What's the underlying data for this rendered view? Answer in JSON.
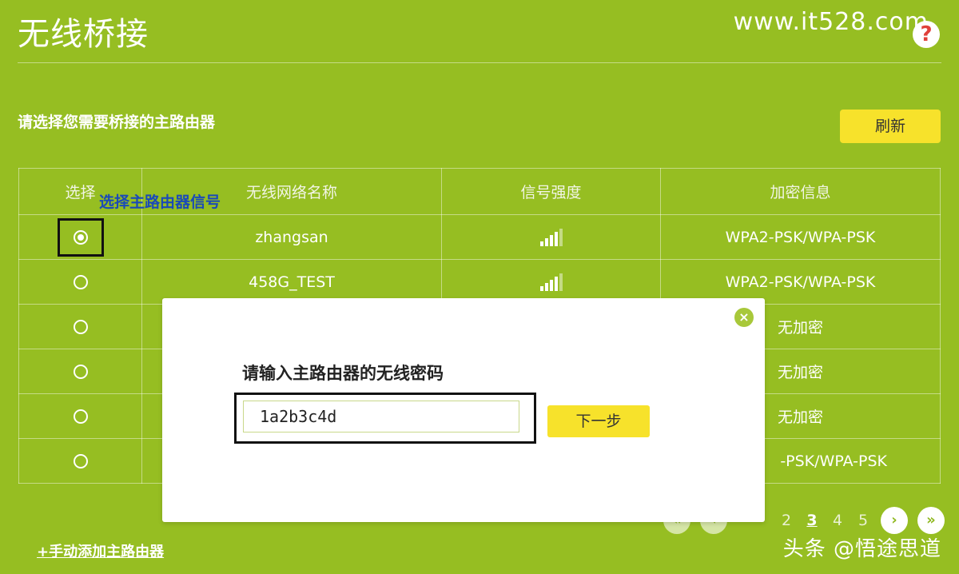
{
  "header": {
    "title": "无线桥接",
    "site_watermark": "www.it528.com",
    "help_label": "?"
  },
  "section": {
    "label": "请选择您需要桥接的主路由器",
    "refresh_label": "刷新"
  },
  "table": {
    "columns": [
      "选择",
      "无线网络名称",
      "信号强度",
      "加密信息"
    ],
    "rows": [
      {
        "selected": true,
        "ssid": "zhangsan",
        "signal_level": 4,
        "encryption": "WPA2-PSK/WPA-PSK"
      },
      {
        "selected": false,
        "ssid": "458G_TEST",
        "signal_level": 4,
        "encryption": "WPA2-PSK/WPA-PSK"
      },
      {
        "selected": false,
        "ssid": "",
        "signal_level": null,
        "encryption": "无加密"
      },
      {
        "selected": false,
        "ssid": "",
        "signal_level": null,
        "encryption": "无加密"
      },
      {
        "selected": false,
        "ssid": "",
        "signal_level": null,
        "encryption": "无加密"
      },
      {
        "selected": false,
        "ssid": "",
        "signal_level": null,
        "encryption": "-PSK/WPA-PSK"
      }
    ]
  },
  "annotation": "选择主路由器信号",
  "add_router_link": "+手动添加主路由器",
  "pagination": {
    "first_icon": "first-page-icon",
    "prev_icon": "prev-page-icon",
    "next_icon": "next-page-icon",
    "last_icon": "last-page-icon",
    "pages": [
      "2",
      "3",
      "4",
      "5"
    ],
    "current_page": "3"
  },
  "modal": {
    "label": "请输入主路由器的无线密码",
    "password_value": "1a2b3c4d",
    "next_label": "下一步",
    "close_icon": "close-icon"
  },
  "bottom_watermark": "头条 @悟途思道",
  "colors": {
    "background": "#96be22",
    "button_yellow": "#f7e22b",
    "annotation_blue": "#1a4ab8",
    "help_red": "#e0403a"
  }
}
